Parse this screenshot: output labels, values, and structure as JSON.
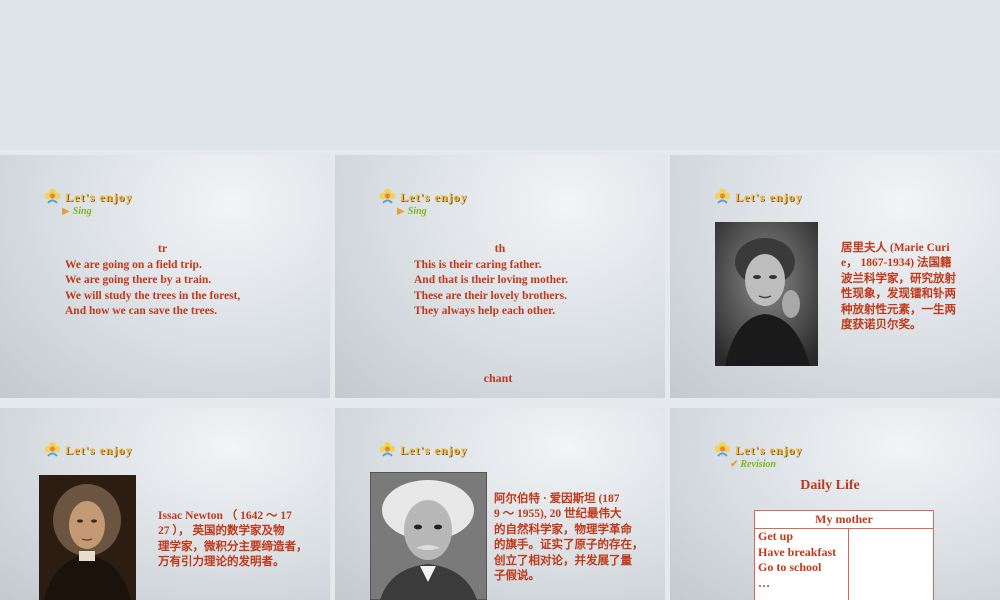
{
  "slide1": {
    "header": "Let's enjoy",
    "sub": "Sing",
    "title": "tr",
    "lines": [
      "We are going on a field trip.",
      "We are going there by a train.",
      "We will study the trees in the forest,",
      "And how we can save the trees."
    ]
  },
  "slide2": {
    "header": "Let's enjoy",
    "sub": "Sing",
    "title": "th",
    "lines": [
      "This is their caring father.",
      "And that is their loving mother.",
      "These are their lovely brothers.",
      "They always help each other."
    ],
    "footer": "chant"
  },
  "slide3": {
    "header": "Let's enjoy",
    "bio_lines": [
      "居里夫人 (Marie Curi",
      "e， 1867-1934) 法国籍",
      "波兰科学家，研究放射",
      "性现象，发现镭和钋两",
      "种放射性元素，一生两",
      "度获诺贝尔奖。"
    ]
  },
  "slide4": {
    "header": "Let's enjoy",
    "bio_lines": [
      "Issac Newton （ 1642 ～ 17",
      "27 ）， 英国的数学家及物",
      "理学家，微积分主要缔造者，",
      "万有引力理论的发明者。"
    ]
  },
  "slide5": {
    "header": "Let's enjoy",
    "bio_lines": [
      "阿尔伯特 · 爱因斯坦 (187",
      "9 ～ 1955), 20 世纪最伟大",
      "的自然科学家，物理学革命",
      "的旗手。证实了原子的存在，",
      "创立了相对论，并发展了量",
      "子假说。"
    ]
  },
  "slide6": {
    "header": "Let's enjoy",
    "sub": "Revision",
    "title": "Daily Life",
    "table_header": "My mother",
    "items": [
      "Get up",
      "Have breakfast",
      "Go to school",
      "…"
    ]
  },
  "colors": {
    "text_red": "#c0391a",
    "header_gold": "#f4b942",
    "sub_green": "#7bb820"
  }
}
